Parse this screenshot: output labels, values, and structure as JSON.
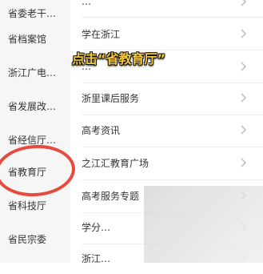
{
  "sidebar": {
    "items": [
      {
        "label": "省委老干…"
      },
      {
        "label": "省档案馆"
      },
      {
        "label": "浙江广电…"
      },
      {
        "label": "省发展改…"
      },
      {
        "label": "省经信厅…"
      },
      {
        "label": "省教育厅"
      },
      {
        "label": "省科技厅"
      },
      {
        "label": "省民宗委"
      }
    ]
  },
  "main": {
    "rows": [
      {
        "label": "…"
      },
      {
        "label": "学在浙江"
      },
      {
        "label": "…"
      },
      {
        "label": "浙里课后服务"
      },
      {
        "label": "高考资讯"
      },
      {
        "label": "之江汇教育广场"
      },
      {
        "label": "高考服务专题"
      },
      {
        "label": "学分…"
      },
      {
        "label": "浙江…"
      }
    ]
  },
  "annotation": {
    "text": "点击“省教育厅”"
  },
  "colors": {
    "annotation": "#f4c83a",
    "circle": "#e84a3e"
  }
}
